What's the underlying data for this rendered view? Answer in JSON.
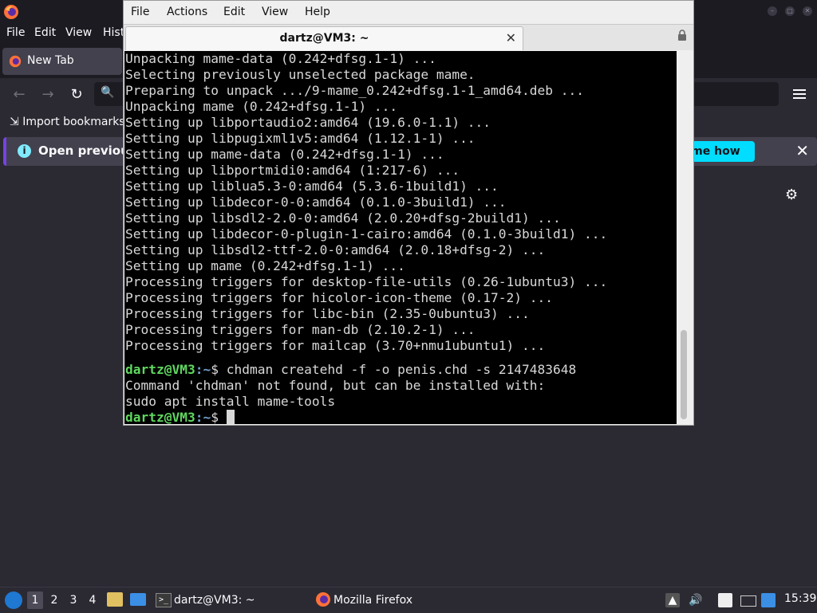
{
  "firefox": {
    "menu": [
      "File",
      "Edit",
      "View",
      "Hist"
    ],
    "tab_label": "New Tab",
    "bookmarks_label": "Import bookmarks",
    "notification_text": "Open previous",
    "notification_button": "w me how",
    "close_glyph": "✕",
    "gear_glyph": "⚙",
    "back_glyph": "←",
    "forward_glyph": "→",
    "reload_glyph": "↻",
    "search_glyph": "🔍",
    "info_glyph": "i"
  },
  "terminal": {
    "menu": [
      "File",
      "Actions",
      "Edit",
      "View",
      "Help"
    ],
    "tab_title": "dartz@VM3: ~",
    "tab_close_glyph": "✕",
    "lines": [
      "Unpacking mame-data (0.242+dfsg.1-1) ...",
      "Selecting previously unselected package mame.",
      "Preparing to unpack .../9-mame_0.242+dfsg.1-1_amd64.deb ...",
      "Unpacking mame (0.242+dfsg.1-1) ...",
      "Setting up libportaudio2:amd64 (19.6.0-1.1) ...",
      "Setting up libpugixml1v5:amd64 (1.12.1-1) ...",
      "Setting up mame-data (0.242+dfsg.1-1) ...",
      "Setting up libportmidi0:amd64 (1:217-6) ...",
      "Setting up liblua5.3-0:amd64 (5.3.6-1build1) ...",
      "Setting up libdecor-0-0:amd64 (0.1.0-3build1) ...",
      "Setting up libsdl2-2.0-0:amd64 (2.0.20+dfsg-2build1) ...",
      "Setting up libdecor-0-plugin-1-cairo:amd64 (0.1.0-3build1) ...",
      "Setting up libsdl2-ttf-2.0-0:amd64 (2.0.18+dfsg-2) ...",
      "Setting up mame (0.242+dfsg.1-1) ...",
      "Processing triggers for desktop-file-utils (0.26-1ubuntu3) ...",
      "Processing triggers for hicolor-icon-theme (0.17-2) ...",
      "Processing triggers for libc-bin (2.35-0ubuntu3) ...",
      "Processing triggers for man-db (2.10.2-1) ...",
      "Processing triggers for mailcap (3.70+nmu1ubuntu1) ..."
    ],
    "prompt_user": "dartz@VM3",
    "prompt_path": ":~",
    "prompt_symbol": "$ ",
    "command": "chdman createhd -f -o penis.chd -s 2147483648",
    "error_line": "Command 'chdman' not found, but can be installed with:",
    "suggestion_line": "sudo apt install mame-tools"
  },
  "taskbar": {
    "workspaces": [
      "1",
      "2",
      "3",
      "4"
    ],
    "task_terminal": "dartz@VM3: ~",
    "task_firefox": "Mozilla Firefox",
    "volume_glyph": "🔊",
    "clock": "15:39"
  }
}
